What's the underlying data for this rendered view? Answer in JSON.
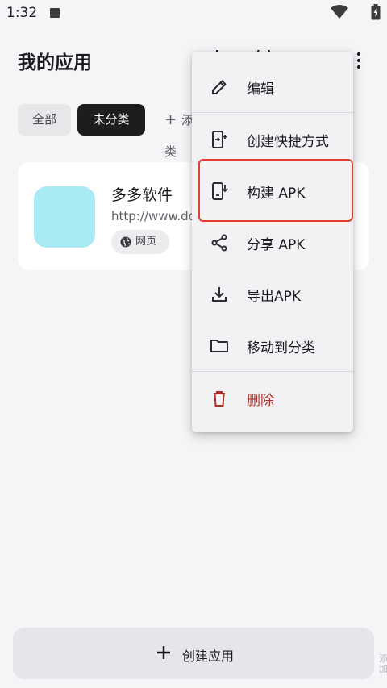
{
  "status_bar": {
    "time": "1:32"
  },
  "header": {
    "title": "我的应用"
  },
  "categories": {
    "all": "全部",
    "uncategorized": "未分类",
    "add": "添加分类"
  },
  "app": {
    "name": "多多软件",
    "url": "http://www.dd",
    "tag": "网页",
    "icon_color": "#a9eaf3"
  },
  "menu": {
    "items": [
      {
        "label": "编辑",
        "icon": "pencil-icon"
      },
      {
        "label": "创建快捷方式",
        "icon": "add-shortcut-icon"
      },
      {
        "label": "构建 APK",
        "icon": "build-apk-icon"
      },
      {
        "label": "分享 APK",
        "icon": "share-icon"
      },
      {
        "label": "导出APK",
        "icon": "download-icon"
      },
      {
        "label": "移动到分类",
        "icon": "folder-icon"
      },
      {
        "label": "删除",
        "icon": "trash-icon"
      }
    ],
    "danger_color": "#a8322b",
    "highlight_color": "#e0412e"
  },
  "bottom": {
    "create_label": "创建应用"
  },
  "edge": {
    "text": "添加"
  }
}
